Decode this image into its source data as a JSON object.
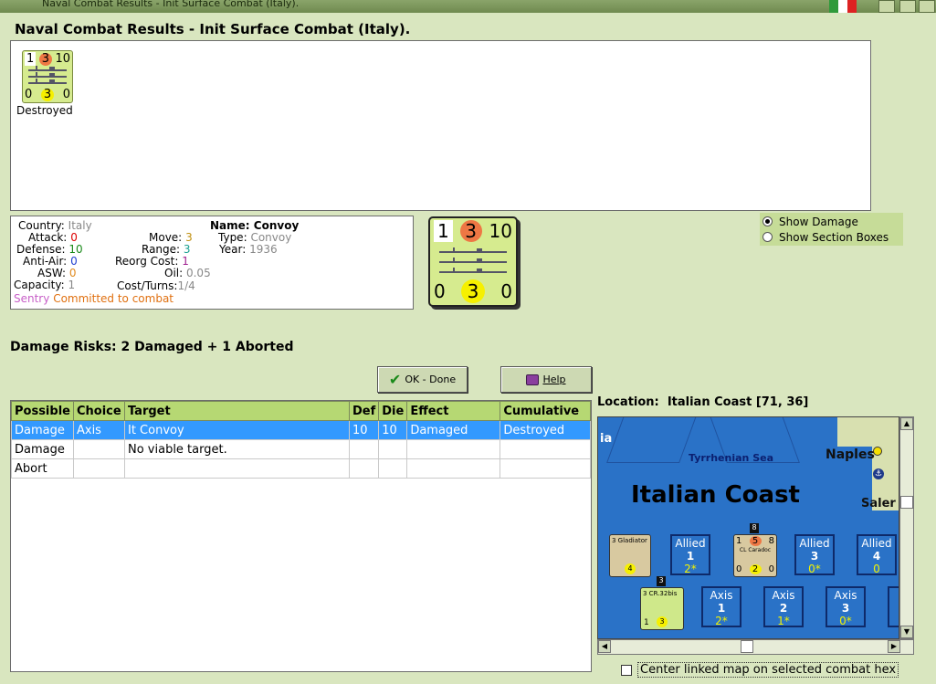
{
  "window": {
    "title": "Naval Combat Results - Init Surface Combat (Italy).",
    "colors": {
      "panel": "#d9e6bf",
      "header_green": "#b6d873",
      "selection": "#3399ff",
      "sea": "#2a72c7"
    }
  },
  "heading": "Naval Combat Results - Init Surface Combat (Italy).",
  "results": {
    "unit": {
      "top_left": "1",
      "top_mid": "3",
      "top_right": "10",
      "bot_left": "0",
      "bot_mid": "3",
      "bot_right": "0"
    },
    "status": "Destroyed"
  },
  "info": {
    "country_label": "Country:",
    "country": "Italy",
    "attack_label": "Attack:",
    "attack": "0",
    "defense_label": "Defense:",
    "defense": "10",
    "antiair_label": "Anti-Air:",
    "antiair": "0",
    "asw_label": "ASW:",
    "asw": "0",
    "capacity_label": "Capacity:",
    "capacity": "1",
    "move_label": "Move:",
    "move": "3",
    "range_label": "Range:",
    "range": "3",
    "reorg_label": "Reorg Cost:",
    "reorg": "1",
    "oil_label": "Oil:",
    "oil": "0.05",
    "costturns_label": "Cost/Turns:",
    "costturns": "1/4",
    "name_label": "Name:",
    "name": "Convoy",
    "type_label": "Type:",
    "type": "Convoy",
    "year_label": "Year:",
    "year": "1936",
    "sentry": "Sentry",
    "committed": "Committed to combat"
  },
  "big_counter": {
    "top_left": "1",
    "top_mid": "3",
    "top_right": "10",
    "bot_left": "0",
    "bot_mid": "3",
    "bot_right": "0"
  },
  "options": {
    "show_damage": "Show Damage",
    "show_section_boxes": "Show Section Boxes",
    "selected": "show_damage"
  },
  "damage_risks": "Damage Risks:  2 Damaged + 1 Aborted",
  "buttons": {
    "ok": "OK - Done",
    "help": "Help"
  },
  "table": {
    "headers": [
      "Possible",
      "Choice",
      "Target",
      "Def",
      "Die",
      "Effect",
      "Cumulative"
    ],
    "rows": [
      [
        "Damage",
        "Axis",
        "It Convoy",
        "10",
        "10",
        "Damaged",
        "Destroyed"
      ],
      [
        "Damage",
        "",
        "No viable target.",
        "",
        "",
        "",
        ""
      ],
      [
        "Abort",
        "",
        "",
        "",
        "",
        "",
        ""
      ]
    ]
  },
  "location": {
    "label": "Location:",
    "value": "Italian Coast [71, 36]"
  },
  "map": {
    "region_title": "Italian Coast",
    "sea_name": "Tyrrhenian Sea",
    "city1": "Naples",
    "city2": "Saler",
    "edge_text": "ia",
    "counters": [
      {
        "name": "3 Gladiator",
        "value": "4"
      },
      {
        "name": "CL Caradoc",
        "top": "1",
        "mid": "5",
        "right": "8",
        "bot_mid": "2",
        "bot_left": "0",
        "bot_right": "0",
        "badge": "8"
      },
      {
        "name": "3 CR.32bis",
        "bot_left": "1",
        "bot_mid": "3",
        "badge": "3"
      }
    ],
    "boxes": [
      {
        "side": "Allied",
        "num": "1",
        "val": "2*"
      },
      {
        "side": "Allied",
        "num": "3",
        "val": "0*"
      },
      {
        "side": "Allied",
        "num": "4",
        "val": "0"
      },
      {
        "side": "Axis",
        "num": "1",
        "val": "2*"
      },
      {
        "side": "Axis",
        "num": "2",
        "val": "1*"
      },
      {
        "side": "Axis",
        "num": "3",
        "val": "0*"
      }
    ]
  },
  "center_checkbox": "Center linked map on selected combat hex"
}
